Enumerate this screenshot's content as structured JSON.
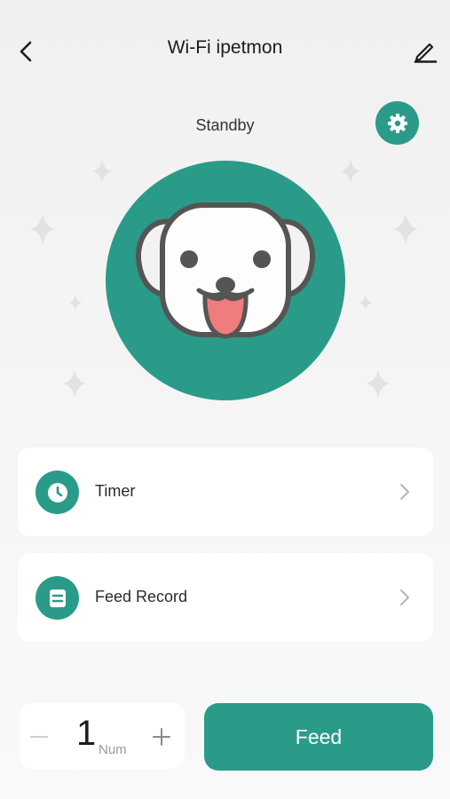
{
  "header": {
    "title": "Wi-Fi ipetmon",
    "back_icon": "chevron-left-icon",
    "edit_icon": "pencil-icon"
  },
  "device": {
    "status": "Standby",
    "settings_icon": "gear-icon",
    "pet_icon": "dog-face-icon"
  },
  "menu": [
    {
      "label": "Timer",
      "icon": "clock-icon"
    },
    {
      "label": "Feed Record",
      "icon": "document-icon"
    }
  ],
  "stepper": {
    "value": "1",
    "unit": "Num",
    "minus": "minus-icon",
    "plus": "plus-icon"
  },
  "feed_button": {
    "label": "Feed"
  },
  "colors": {
    "accent": "#2a9b89",
    "tongue": "#ef7d7d",
    "background": "#f3f3f3"
  }
}
